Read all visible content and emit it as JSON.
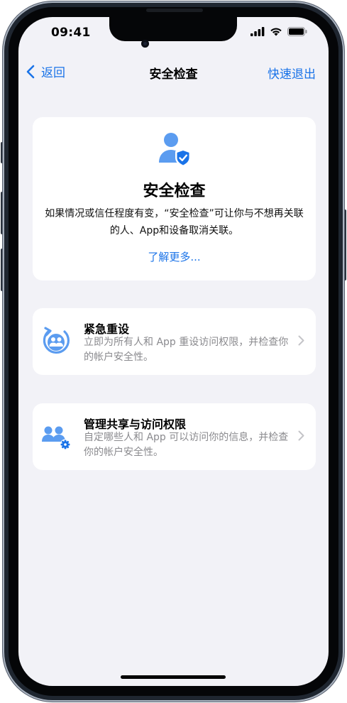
{
  "status_bar": {
    "time": "09:41"
  },
  "nav": {
    "back_label": "返回",
    "title": "安全检查",
    "quick_exit_label": "快速退出"
  },
  "hero": {
    "title": "安全检查",
    "description": "如果情况或信任程度有变，“安全检查”可让你与不想再关联的人、App和设备取消关联。",
    "learn_more": "了解更多..."
  },
  "options": [
    {
      "title": "紧急重设",
      "description": "立即为所有人和 App 重设访问权限，并检查你的帐户安全性。",
      "icon": "emergency-reset-icon"
    },
    {
      "title": "管理共享与访问权限",
      "description": "自定哪些人和 App 可以访问你的信息，并检查你的帐户安全性。",
      "icon": "manage-sharing-icon"
    }
  ],
  "colors": {
    "accent": "#1a73e8",
    "icon_blue": "#5b9cf0",
    "background": "#f2f2f7",
    "secondary_text": "#8a8a8e"
  }
}
